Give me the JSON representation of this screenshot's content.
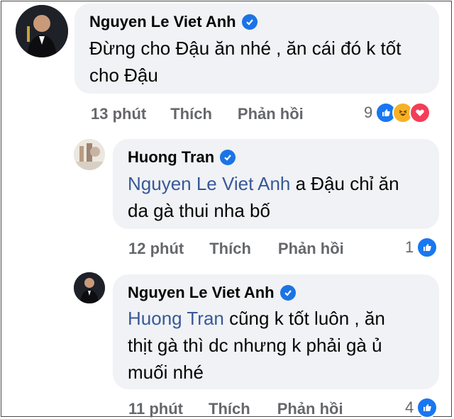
{
  "comments": [
    {
      "author": "Nguyen Le Viet Anh",
      "text": "Đừng cho Đậu ăn nhé , ăn cái đó k tốt cho Đậu",
      "line1": "Đừng cho Đậu ăn nhé , ăn cái đó k tốt",
      "line2": "cho Đậu",
      "time": "13 phút",
      "like": "Thích",
      "reply": "Phản hồi",
      "reaction_count": "9"
    },
    {
      "author": "Huong Tran",
      "mention": "Nguyen Le Viet Anh",
      "line1_rest": " a Đậu chỉ ăn",
      "line2": "da gà thui nha bố",
      "time": "12 phút",
      "like": "Thích",
      "reply": "Phản hồi",
      "reaction_count": "1"
    },
    {
      "author": "Nguyen Le Viet Anh",
      "mention": "Huong Tran",
      "line1_rest": " cũng k tốt luôn , ăn",
      "line2": "thịt gà thì dc nhưng k phải gà ủ",
      "line3": "muối nhé",
      "time": "11 phút",
      "like": "Thích",
      "reply": "Phản hồi",
      "reaction_count": "4"
    }
  ],
  "colors": {
    "bubble": "#f0f2f5",
    "mention": "#385898",
    "meta": "#65676b",
    "verified": "#1b74e4",
    "like": "#1877f2",
    "haha": "#f7b125",
    "love": "#f33e58"
  },
  "icons": [
    "verified-badge-icon",
    "like-reaction-icon",
    "haha-reaction-icon",
    "love-reaction-icon"
  ]
}
